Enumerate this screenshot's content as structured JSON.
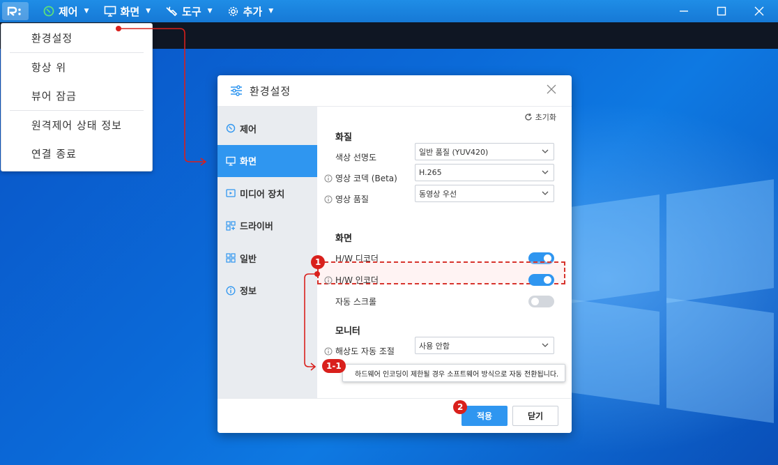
{
  "toolbar": {
    "menus": [
      {
        "label": "제어",
        "icon": "control-icon"
      },
      {
        "label": "화면",
        "icon": "monitor-icon"
      },
      {
        "label": "도구",
        "icon": "wrench-icon"
      },
      {
        "label": "추가",
        "icon": "gear-icon"
      }
    ]
  },
  "dropdown": {
    "items": [
      "환경설정",
      "항상 위",
      "뷰어 잠금",
      "원격제어 상태 정보",
      "연결 종료"
    ]
  },
  "dialog": {
    "title": "환경설정",
    "sidebar": [
      {
        "label": "제어",
        "icon": "control-icon",
        "active": false
      },
      {
        "label": "화면",
        "icon": "monitor-icon",
        "active": true
      },
      {
        "label": "미디어 장치",
        "icon": "media-icon",
        "active": false
      },
      {
        "label": "드라이버",
        "icon": "driver-icon",
        "active": false
      },
      {
        "label": "일반",
        "icon": "grid-icon",
        "active": false
      },
      {
        "label": "정보",
        "icon": "info-icon",
        "active": false
      }
    ],
    "reset_label": "초기화",
    "quality": {
      "title": "화질",
      "color_clarity_label": "색상 선명도",
      "color_clarity_value": "일반 품질 (YUV420)",
      "codec_label": "영상 코덱 (Beta)",
      "codec_value": "H.265",
      "video_quality_label": "영상 품질",
      "video_quality_value": "동영상 우선"
    },
    "screen": {
      "title": "화면",
      "hw_decoder_label": "H/W 디코더",
      "hw_decoder_on": true,
      "hw_encoder_label": "H/W 인코더",
      "hw_encoder_on": true,
      "auto_scroll_label": "자동 스크롤",
      "auto_scroll_on": false
    },
    "monitor": {
      "title": "모니터",
      "auto_resolution_label": "해상도 자동 조절",
      "auto_resolution_value": "사용 안함"
    },
    "apply_label": "적용",
    "close_label": "닫기"
  },
  "tooltip": "하드웨어 인코딩이 제한될 경우 소프트웨어 방식으로 자동 전환됩니다.",
  "badges": {
    "one": "1",
    "one_one": "1-1",
    "two": "2"
  },
  "colors": {
    "accent": "#2f96f0",
    "annotation": "#d9201c",
    "toolbar": "#1679d6"
  }
}
